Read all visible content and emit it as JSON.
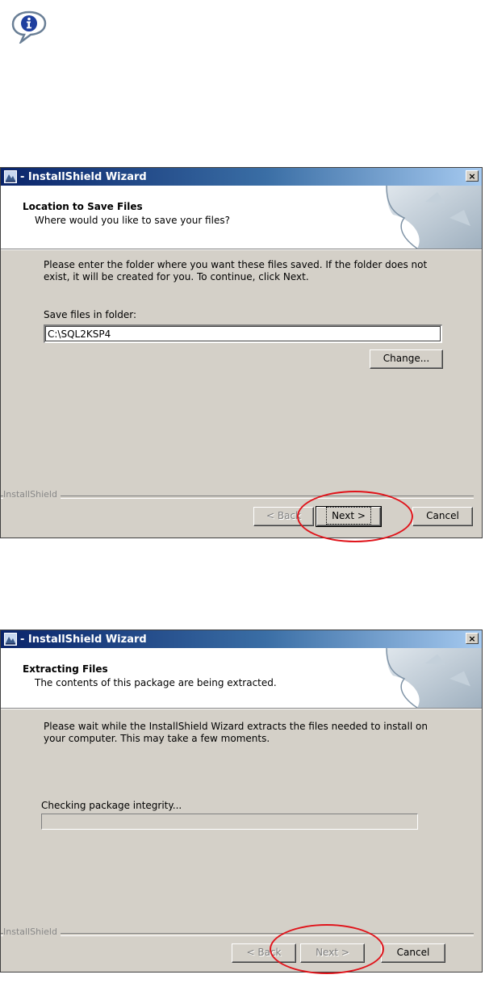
{
  "dialog1": {
    "title": "- InstallShield Wizard",
    "close_label": "×",
    "header": {
      "title": "Location to Save Files",
      "subtitle": "Where would you like to save your files?"
    },
    "body_text": "Please enter the folder where you want these files saved.  If the folder does not exist, it will be created for you.   To continue, click Next.",
    "field_label": "Save files in folder:",
    "folder_value": "C:\\SQL2KSP4",
    "change_button": "Change...",
    "brand": "InstallShield",
    "back_button": "< Back",
    "next_button": "Next >",
    "cancel_button": "Cancel"
  },
  "dialog2": {
    "title": "- InstallShield Wizard",
    "close_label": "×",
    "header": {
      "title": "Extracting Files",
      "subtitle": "The contents of this package are being extracted."
    },
    "body_text": "Please wait while the InstallShield Wizard extracts the files needed to install  on your computer.  This may take a few moments.",
    "status_text": "Checking package integrity...",
    "progress_percent": 0,
    "brand": "InstallShield",
    "back_button": "< Back",
    "next_button": "Next >",
    "cancel_button": "Cancel"
  },
  "colors": {
    "titlebar_start": "#0a246a",
    "titlebar_end": "#a6caf0",
    "dialog_bg": "#d4d0c8",
    "annotation_red": "#e0141b"
  }
}
